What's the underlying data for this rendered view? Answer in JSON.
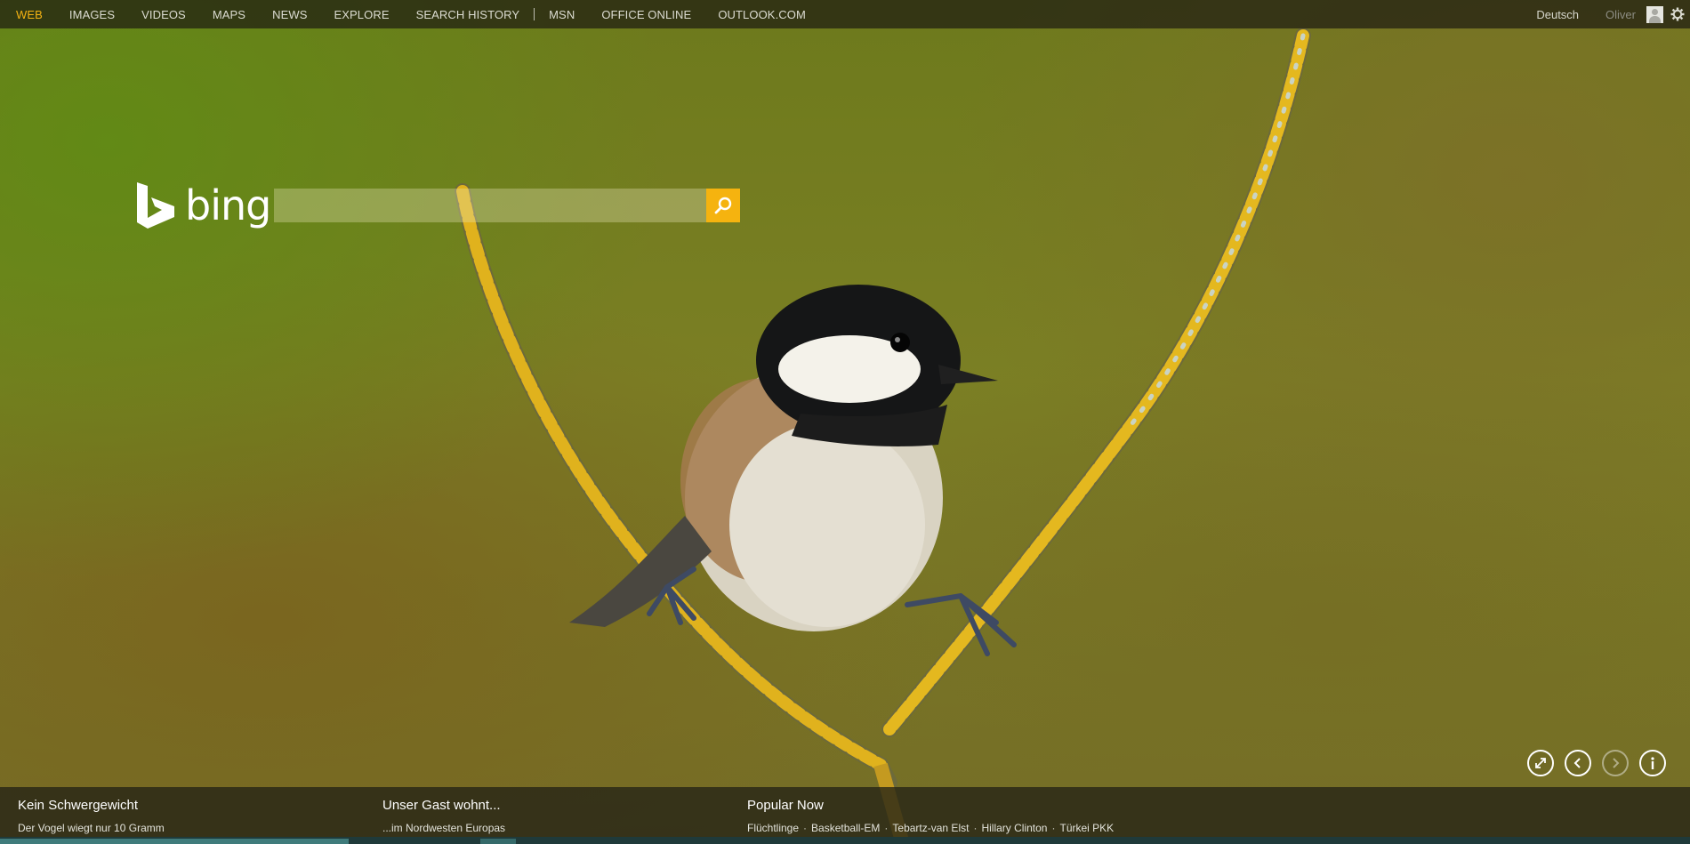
{
  "nav": {
    "items": [
      {
        "label": "WEB",
        "active": true
      },
      {
        "label": "IMAGES"
      },
      {
        "label": "VIDEOS"
      },
      {
        "label": "MAPS"
      },
      {
        "label": "NEWS"
      },
      {
        "label": "EXPLORE"
      },
      {
        "label": "SEARCH HISTORY"
      }
    ],
    "secondary": [
      {
        "label": "MSN"
      },
      {
        "label": "OFFICE ONLINE"
      },
      {
        "label": "OUTLOOK.COM"
      }
    ]
  },
  "account": {
    "language": "Deutsch",
    "user_name": "Oliver",
    "avatar_icon": "user-avatar-icon",
    "settings_icon": "gear-icon"
  },
  "brand": {
    "logo_text": "bing",
    "accent_color": "#f5b30f"
  },
  "search": {
    "value": "",
    "placeholder": "",
    "button_icon": "search-icon"
  },
  "image_controls": [
    {
      "name": "fullscreen-button",
      "icon": "expand-icon"
    },
    {
      "name": "previous-image-button",
      "icon": "chevron-left-icon"
    },
    {
      "name": "next-image-button",
      "icon": "chevron-right-icon",
      "disabled": true
    },
    {
      "name": "info-button",
      "icon": "info-icon"
    }
  ],
  "bottom": {
    "story1": {
      "title": "Kein Schwergewicht",
      "subtitle": "Der Vogel wiegt nur 10 Gramm"
    },
    "story2": {
      "title": "Unser Gast wohnt...",
      "subtitle": "...im Nordwesten Europas"
    },
    "popular": {
      "title": "Popular Now",
      "items": [
        "Flüchtlinge",
        "Basketball-EM",
        "Tebartz-van Elst",
        "Hillary Clinton",
        "Türkei PKK"
      ]
    }
  }
}
